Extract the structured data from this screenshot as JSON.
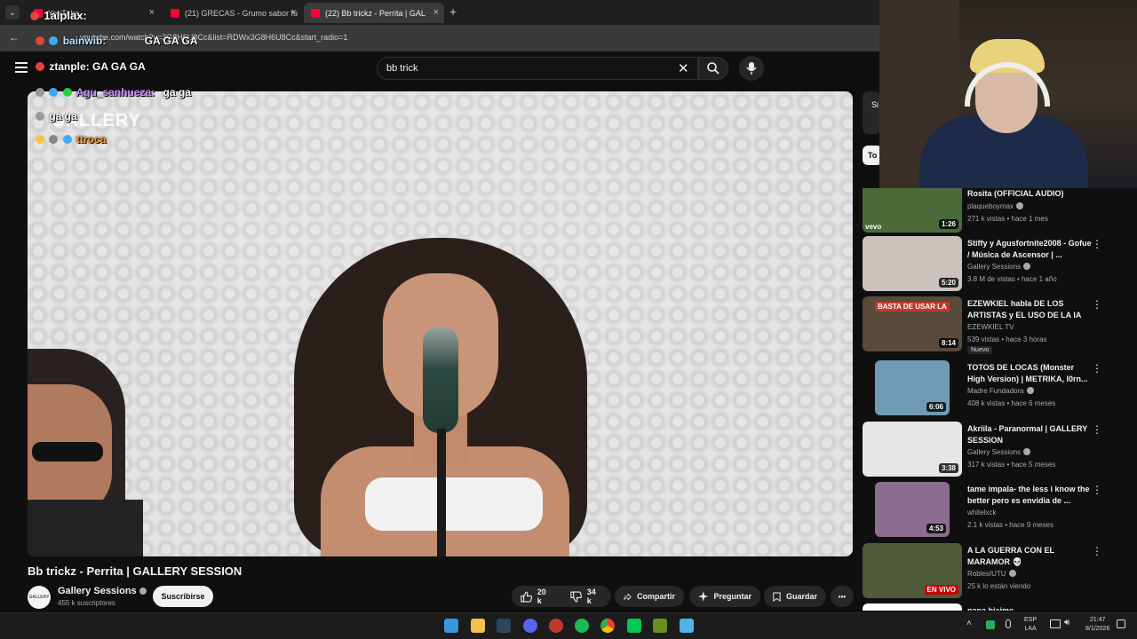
{
  "browser": {
    "tabs": [
      {
        "label": "YouTube",
        "close": "×"
      },
      {
        "label": "(21) GRECAS - Grumo sabor fu",
        "close": "×"
      },
      {
        "label": "(22) Bb trickz - Perrita | GAL",
        "close": "×"
      }
    ],
    "new_tab": "+",
    "url": "youtube.com/watch?v=3G8H6U8Cc&list=RDWx3G8H6U8Cc&start_radio=1"
  },
  "search": {
    "query": "bb trick"
  },
  "chat_overlay": [
    {
      "user": "1alplax:",
      "text": "",
      "color": "#ffffff"
    },
    {
      "user": "bainwib:",
      "text": "GA GA GA",
      "color": "#b9e5ff"
    },
    {
      "user": "ztanple:",
      "text": "GA GA GA",
      "color": "#ffffff"
    },
    {
      "user": "Agu_sanhueza:",
      "text": "ga ga",
      "color": "#c58cff"
    },
    {
      "user": "",
      "text": "ga ga",
      "color": "#ffffff"
    },
    {
      "user": "ttroca",
      "text": "",
      "color": "#ff9a1f"
    }
  ],
  "video_watermark": "GALLERY",
  "video": {
    "title": "Bb trickz - Perrita | GALLERY SESSION",
    "channel": "Gallery Sessions",
    "subscribers": "455 k suscriptores",
    "subscribe_label": "Suscribirse",
    "avatar_text": "GALLERY",
    "likes": "20 k",
    "dislikes": "34 k",
    "share_label": "Compartir",
    "ask_label": "Preguntar",
    "save_label": "Guardar",
    "more_label": "•••"
  },
  "sidebar": {
    "chip": "To",
    "top_card_text": "Si",
    "recommendations": [
      {
        "title": "Rosita (OFFICIAL AUDIO)",
        "channel": "plaqueboymax",
        "verified": true,
        "meta": "271 k vistas • hace 1 mes",
        "duration": "1:26",
        "thumb": "#4a6a3a",
        "brand": "vevo"
      },
      {
        "title": "Stiffy y Agusfortnite2008 - Gofue / Música de Ascensor | ...",
        "channel": "Gallery Sessions",
        "verified": true,
        "meta": "3.8 M de vistas • hace 1 año",
        "duration": "5:20",
        "thumb": "#c9c2bd"
      },
      {
        "title": "EZEWKIEL habla DE LOS ARTISTAS y EL USO DE LA IA",
        "channel": "EZEWKIEL TV",
        "verified": false,
        "meta": "539 vistas • hace 3 horas",
        "duration": "8:14",
        "badge": "Nuevo",
        "thumb": "#5a4a3c",
        "thumb_text": "BASTA DE USAR LA"
      },
      {
        "title": "TOTOS DE LOCAS (Monster High Version) | METRIKA, l0rn...",
        "channel": "Madre Fundadora",
        "verified": true,
        "meta": "408 k vistas • hace 6 meses",
        "duration": "6:06",
        "thumb": "#6f9bb6"
      },
      {
        "title": "Akriila - Paranormal | GALLERY SESSION",
        "channel": "Gallery Sessions",
        "verified": true,
        "meta": "317 k vistas • hace 5 meses",
        "duration": "3:38",
        "thumb": "#e6e6e6"
      },
      {
        "title": "tame impala- the less i know the better pero es envidia de ...",
        "channel": "whitelxck",
        "verified": false,
        "meta": "2.1 k vistas • hace 9 meses",
        "duration": "4:53",
        "thumb": "#8a6d8f"
      },
      {
        "title": "A LA GUERRA CON EL MARAMOR 💀",
        "channel": "RoblesIUTU",
        "verified": true,
        "meta": "25 k lo están viendo",
        "live": "EN VIVO",
        "thumb": "#4f5a3a"
      },
      {
        "title": "papa biaime",
        "channel": "",
        "verified": false,
        "meta": "",
        "thumb": "#ffffff"
      }
    ]
  },
  "taskbar": {
    "lang_top": "ESP",
    "lang_bottom": "LAA",
    "time": "21:47",
    "date": "8/1/2026"
  }
}
